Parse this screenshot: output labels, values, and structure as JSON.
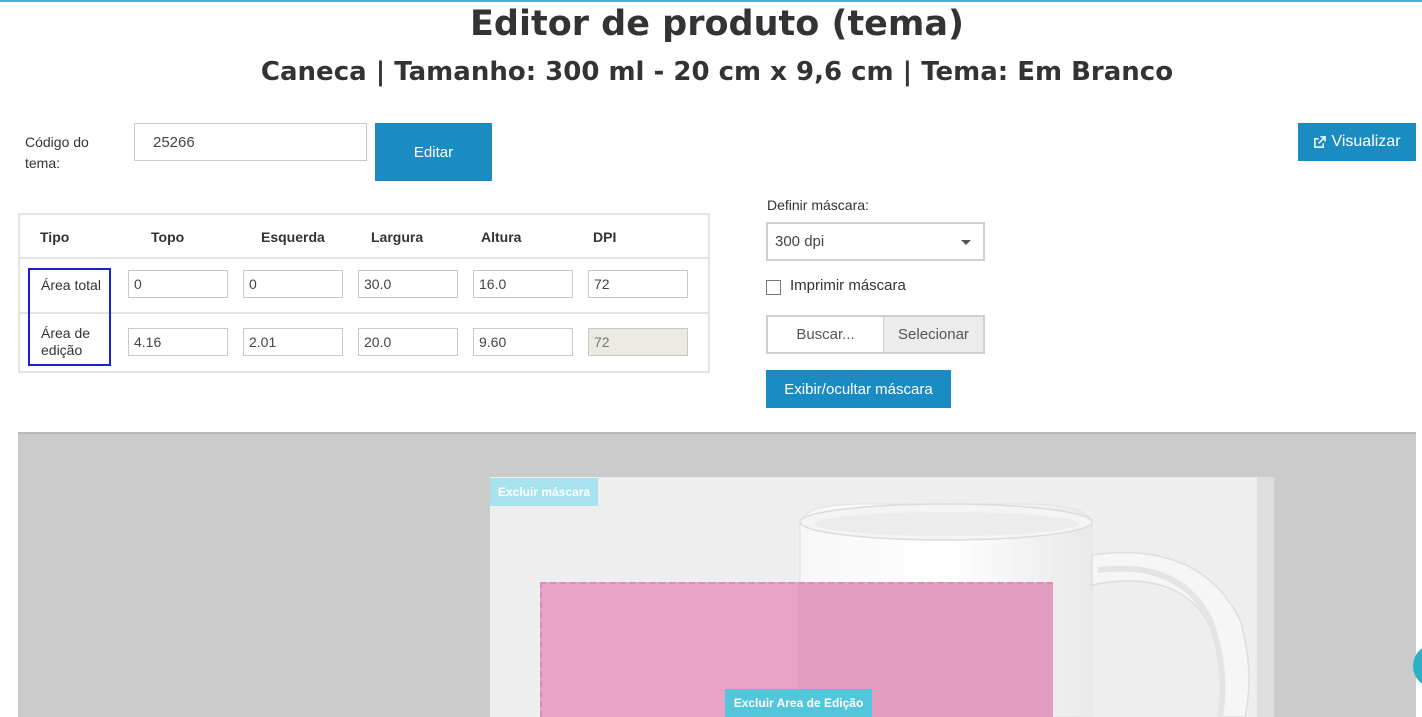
{
  "header": {
    "title": "Editor de produto (tema)",
    "subtitle": "Caneca | Tamanho: 300 ml - 20 cm x 9,6 cm | Tema: Em Branco"
  },
  "theme_code": {
    "label": "Código do tema:",
    "value": "25266",
    "edit_button": "Editar"
  },
  "preview_button": {
    "label": "Visualizar",
    "icon": "external-link-icon"
  },
  "dimensions_table": {
    "columns": [
      "Tipo",
      "Topo",
      "Esquerda",
      "Largura",
      "Altura",
      "DPI"
    ],
    "rows": [
      {
        "type": "Área total",
        "top": "0",
        "left": "0",
        "width": "30.0",
        "height": "16.0",
        "dpi": "72"
      },
      {
        "type": "Área de edição",
        "top": "4.16",
        "left": "2.01",
        "width": "20.0",
        "height": "9.60",
        "dpi": "72"
      }
    ]
  },
  "mask": {
    "label": "Definir máscara:",
    "selected": "300 dpi",
    "print_mask_label": "Imprimir máscara",
    "print_mask_checked": false,
    "file_placeholder": "Buscar...",
    "select_button": "Selecionar",
    "toggle_button": "Exibir/ocultar máscara"
  },
  "canvas": {
    "delete_mask_tag": "Excluir máscara",
    "delete_edit_area_tag": "Excluir Area de Edição"
  },
  "colors": {
    "accent": "#1a8cc1",
    "edit_area": "#e8a3c6",
    "tag": "#54c6db",
    "highlight": "#1a20d8"
  }
}
